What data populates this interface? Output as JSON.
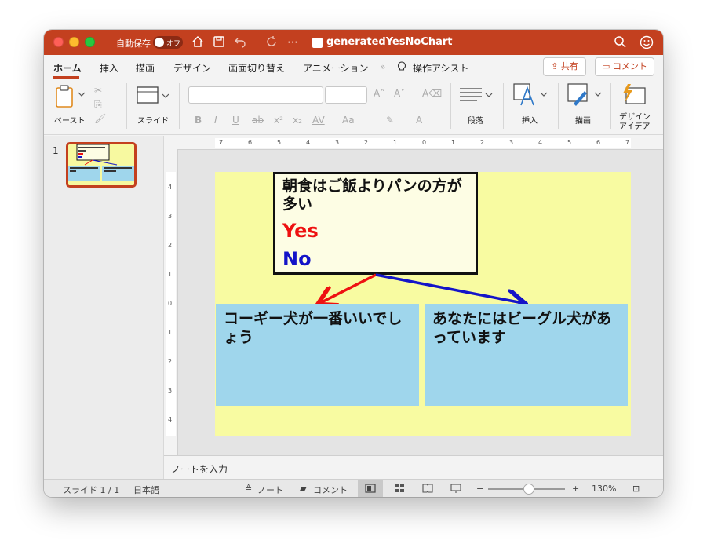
{
  "titlebar": {
    "autosave_label": "自動保存",
    "toggle_label": "オフ",
    "doc_title": "generatedYesNoChart"
  },
  "ribbon_tabs": [
    {
      "label": "ホーム",
      "active": true
    },
    {
      "label": "挿入"
    },
    {
      "label": "描画"
    },
    {
      "label": "デザイン"
    },
    {
      "label": "画面切り替え"
    },
    {
      "label": "アニメーション"
    },
    {
      "label": "操作アシスト"
    }
  ],
  "header_buttons": {
    "share": "共有",
    "comment": "コメント"
  },
  "ribbon": {
    "paste": "ペースト",
    "slide": "スライド",
    "paragraph": "段落",
    "insert": "挿入",
    "draw": "描画",
    "design_ideas_1": "デザイン",
    "design_ideas_2": "アイデア",
    "format": {
      "bold": "B",
      "italic": "I",
      "underline": "U",
      "strike": "ab",
      "super": "x²",
      "sub": "x₂",
      "spacing": "AV",
      "case": "Aa"
    }
  },
  "thumbnails": [
    {
      "number": "1"
    }
  ],
  "hruler_labels": [
    "7",
    "6",
    "5",
    "4",
    "3",
    "2",
    "1",
    "0",
    "1",
    "2",
    "3",
    "4",
    "5",
    "6",
    "7"
  ],
  "vruler_labels": [
    "4",
    "3",
    "2",
    "1",
    "0",
    "1",
    "2",
    "3",
    "4"
  ],
  "slide": {
    "question": "朝食はご飯よりパンの方が多い",
    "yes_label": "Yes",
    "no_label": "No",
    "yes_answer": "コーギー犬が一番いいでしょう",
    "no_answer": "あなたにはビーグル犬があっています",
    "colors": {
      "background": "#f8fba1",
      "question_box": "#fdfde4",
      "answer_box": "#9fd6ec",
      "yes": "#ee1111",
      "no": "#1414c8"
    }
  },
  "notes": {
    "placeholder": "ノートを入力"
  },
  "status": {
    "slide_counter": "スライド 1 / 1",
    "language": "日本語",
    "notes_button": "ノート",
    "comments_button": "コメント",
    "zoom": "130%",
    "zoom_minus": "−",
    "zoom_plus": "+"
  }
}
